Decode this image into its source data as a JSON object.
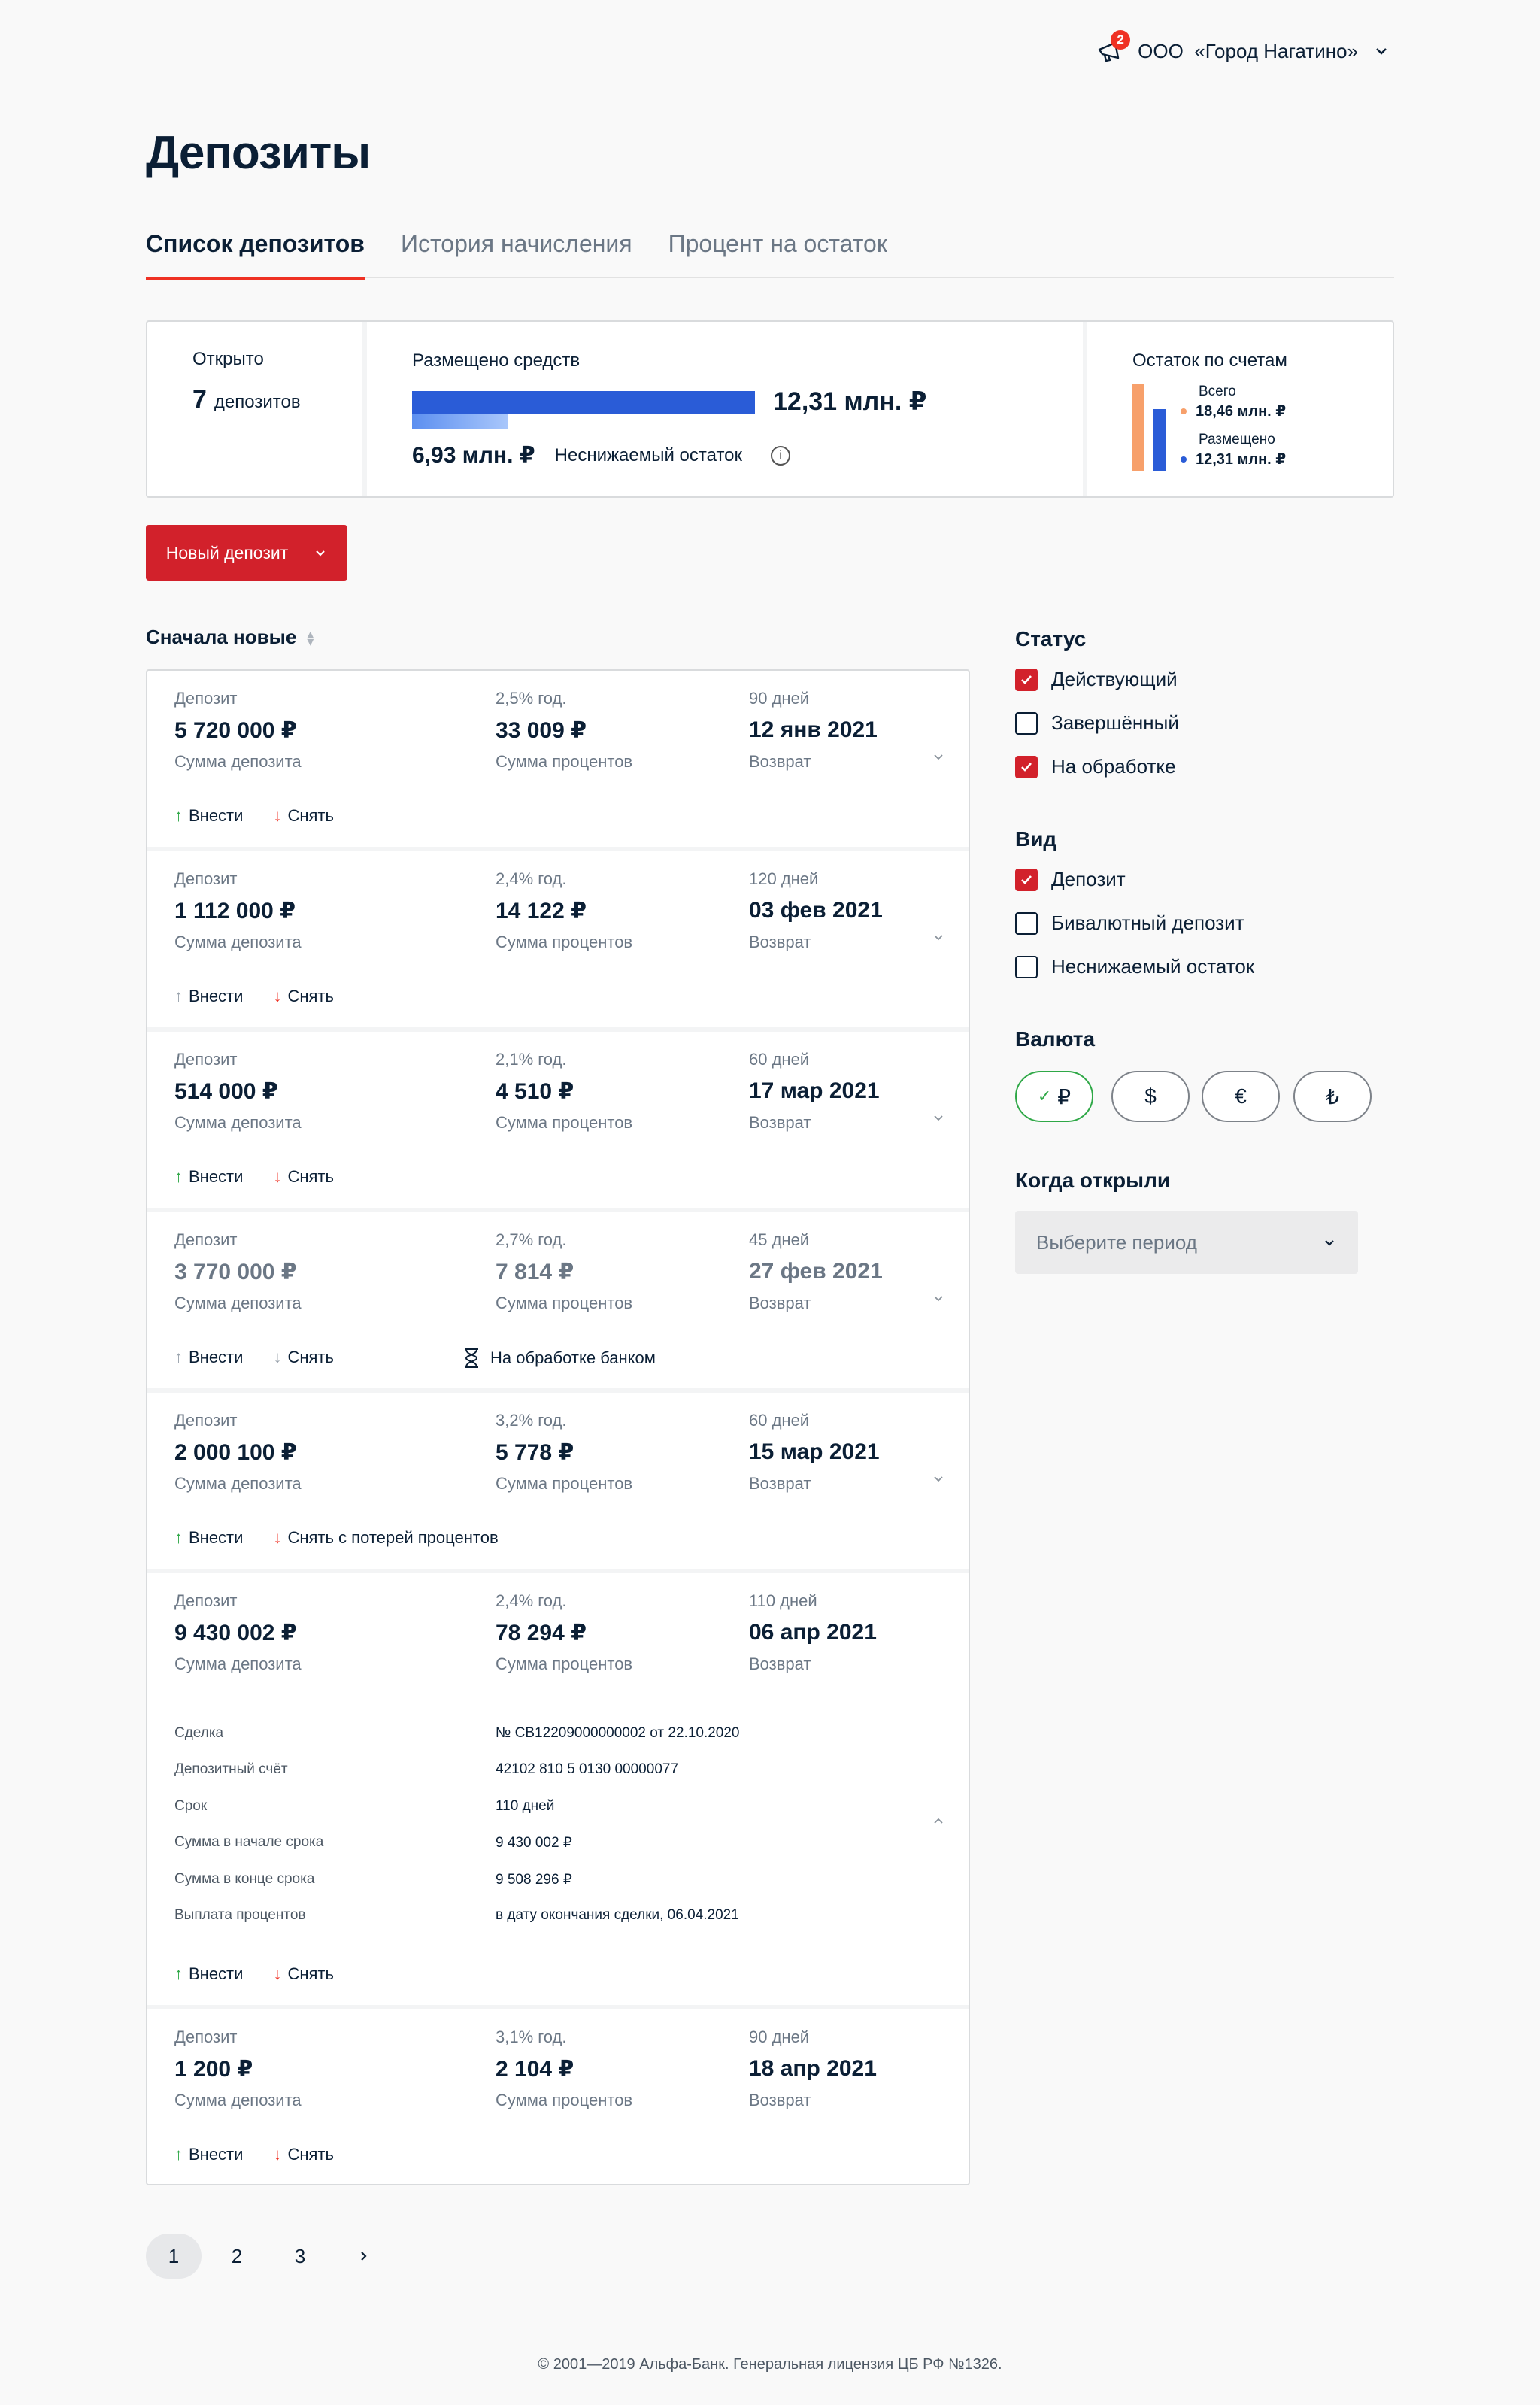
{
  "header": {
    "notifications": "2",
    "org": "ООО  «Город Нагатино»"
  },
  "page": {
    "title": "Депозиты"
  },
  "tabs": [
    "Список депозитов",
    "История начисления",
    "Процент на остаток"
  ],
  "summary": {
    "opened_label": "Открыто",
    "opened_count": "7",
    "opened_unit": "депозитов",
    "placed_label": "Размещено средств",
    "placed_total": "12,31 млн. ₽",
    "placed_share": 0.28,
    "nonreducible_value": "6,93 млн. ₽",
    "nonreducible_label": "Неснижаемый остаток",
    "rest_label": "Остаток по счетам",
    "rest_total_label": "Всего",
    "rest_total": "18,46 млн. ₽",
    "rest_placed_label": "Размещено",
    "rest_placed": "12,31 млн. ₽",
    "colors": {
      "total": "#f7a06b",
      "placed": "#2a5cd7"
    }
  },
  "new_deposit_label": "Новый депозит",
  "sort_label": "Сначала новые",
  "deposits": [
    {
      "type": "Депозит",
      "amount": "5 720 000 ₽",
      "amount_label": "Сумма депозита",
      "rate": "2,5% год.",
      "interest": "33 009 ₽",
      "interest_label": "Сумма процентов",
      "term": "90 дней",
      "return_date": "12 янв 2021",
      "return_label": "Возврат",
      "deposit_label": "Внести",
      "withdraw_label": "Снять"
    },
    {
      "type": "Депозит",
      "amount": "1 112 000 ₽",
      "amount_label": "Сумма депозита",
      "rate": "2,4% год.",
      "interest": "14 122 ₽",
      "interest_label": "Сумма процентов",
      "term": "120 дней",
      "return_date": "03 фев 2021",
      "return_label": "Возврат",
      "deposit_label": "Внести",
      "withdraw_label": "Снять"
    },
    {
      "type": "Депозит",
      "amount": "514 000 ₽",
      "amount_label": "Сумма депозита",
      "rate": "2,1% год.",
      "interest": "4 510 ₽",
      "interest_label": "Сумма процентов",
      "term": "60 дней",
      "return_date": "17 мар 2021",
      "return_label": "Возврат",
      "deposit_label": "Внести",
      "withdraw_label": "Снять"
    },
    {
      "type": "Депозит",
      "amount": "3 770 000 ₽",
      "amount_label": "Сумма депозита",
      "rate": "2,7% год.",
      "interest": "7 814 ₽",
      "interest_label": "Сумма процентов",
      "term": "45 дней",
      "return_date": "27 фев 2021",
      "return_label": "Возврат",
      "deposit_label": "Внести",
      "withdraw_label": "Снять",
      "status": "На обработке банком"
    },
    {
      "type": "Депозит",
      "amount": "2 000 100 ₽",
      "amount_label": "Сумма депозита",
      "rate": "3,2% год.",
      "interest": "5 778 ₽",
      "interest_label": "Сумма процентов",
      "term": "60 дней",
      "return_date": "15 мар 2021",
      "return_label": "Возврат",
      "deposit_label": "Внести",
      "withdraw_label": "Снять с потерей процентов"
    },
    {
      "type": "Депозит",
      "amount": "9 430 002 ₽",
      "amount_label": "Сумма депозита",
      "rate": "2,4% год.",
      "interest": "78 294 ₽",
      "interest_label": "Сумма процентов",
      "term": "110 дней",
      "return_date": "06 апр 2021",
      "return_label": "Возврат",
      "deposit_label": "Внести",
      "withdraw_label": "Снять",
      "details": [
        {
          "k": "Сделка",
          "v": "№ CB12209000000002 от 22.10.2020"
        },
        {
          "k": "Депозитный счёт",
          "v": "42102 810 5 0130 00000077"
        },
        {
          "k": "Срок",
          "v": "110 дней"
        },
        {
          "k": "Сумма в начале срока",
          "v": "9 430 002 ₽"
        },
        {
          "k": "Сумма в конце срока",
          "v": "9 508 296 ₽"
        },
        {
          "k": "Выплата процентов",
          "v": "в дату окончания сделки, 06.04.2021"
        }
      ]
    },
    {
      "type": "Депозит",
      "amount": "1 200 ₽",
      "amount_label": "Сумма депозита",
      "rate": "3,1% год.",
      "interest": "2 104 ₽",
      "interest_label": "Сумма процентов",
      "term": "90 дней",
      "return_date": "18 апр 2021",
      "return_label": "Возврат",
      "deposit_label": "Внести",
      "withdraw_label": "Снять"
    }
  ],
  "filters": {
    "status_title": "Статус",
    "status": [
      {
        "label": "Действующий",
        "checked": true
      },
      {
        "label": "Завершённый",
        "checked": false
      },
      {
        "label": "На обработке",
        "checked": true
      }
    ],
    "kind_title": "Вид",
    "kind": [
      {
        "label": "Депозит",
        "checked": true
      },
      {
        "label": "Бивалютный депозит",
        "checked": false
      },
      {
        "label": "Неснижаемый остаток",
        "checked": false
      }
    ],
    "currency_title": "Валюта",
    "currencies": [
      {
        "symbol": "₽",
        "selected": true
      },
      {
        "symbol": "$",
        "selected": false
      },
      {
        "symbol": "€",
        "selected": false
      },
      {
        "symbol": "₺",
        "selected": false
      }
    ],
    "period_title": "Когда открыли",
    "period_placeholder": "Выберите период"
  },
  "pagination": [
    "1",
    "2",
    "3"
  ],
  "footer": "© 2001—2019 Альфа-Банк. Генеральная лицензия ЦБ РФ №1326."
}
